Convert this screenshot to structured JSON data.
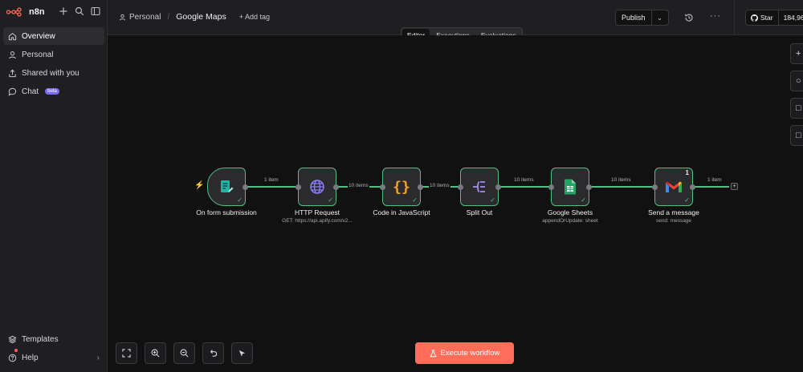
{
  "app": {
    "brand": "n8n"
  },
  "sidebar": {
    "items": [
      {
        "label": "Overview",
        "icon": "home-icon",
        "active": true
      },
      {
        "label": "Personal",
        "icon": "user-icon"
      },
      {
        "label": "Shared with you",
        "icon": "share-icon"
      },
      {
        "label": "Chat",
        "icon": "chat-icon",
        "badge": "beta"
      }
    ],
    "bottom": [
      {
        "label": "Templates",
        "icon": "templates-icon"
      },
      {
        "label": "Help",
        "icon": "help-icon"
      }
    ]
  },
  "header": {
    "project": "Personal",
    "workflow_name": "Google Maps",
    "add_tag": "+ Add tag",
    "publish": "Publish",
    "star_label": "Star",
    "star_count": "184,96"
  },
  "tabs": [
    "Editor",
    "Executions",
    "Evaluations"
  ],
  "nodes": [
    {
      "label": "On form submission",
      "sub": ""
    },
    {
      "label": "HTTP Request",
      "sub": "GET: https://api.apify.com/v2..."
    },
    {
      "label": "Code in JavaScript",
      "sub": ""
    },
    {
      "label": "Split Out",
      "sub": ""
    },
    {
      "label": "Google Sheets",
      "sub": "appendOrUpdate: sheet"
    },
    {
      "label": "Send a message",
      "sub": "send: message",
      "runs": "1"
    }
  ],
  "edges": [
    "1 item",
    "10 items",
    "10 items",
    "10 items",
    "10 items",
    "1 item"
  ],
  "canvas": {
    "execute": "Execute workflow"
  },
  "colors": {
    "accent": "#ff6d5a",
    "success": "#4fbf83",
    "beta": "#7b6cf6"
  }
}
